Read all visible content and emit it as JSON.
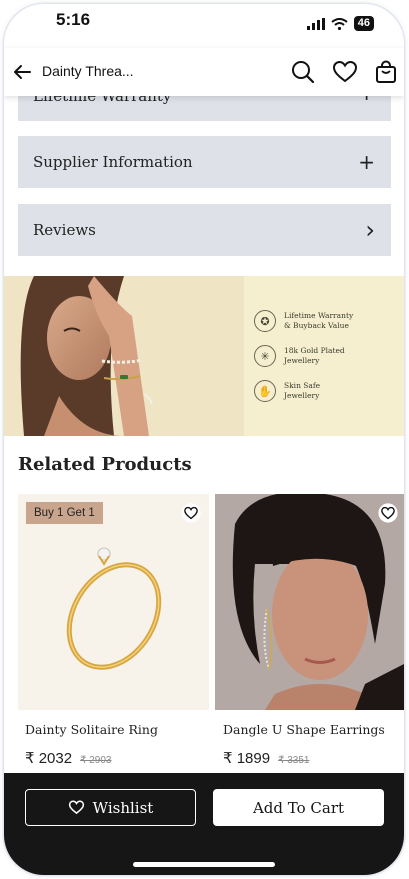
{
  "status": {
    "time": "5:16",
    "battery": "46"
  },
  "header": {
    "title": "Dainty Threa..."
  },
  "accordion": [
    {
      "label": "Lifetime Warranty",
      "sign": "+"
    },
    {
      "label": "Supplier Information",
      "sign": "+"
    },
    {
      "label": "Reviews",
      "sign": "›"
    }
  ],
  "banner": {
    "features": [
      {
        "line1": "Lifetime Warranty",
        "line2": "& Buyback Value",
        "icon": "certificate-icon"
      },
      {
        "line1": "18k Gold Plated",
        "line2": "Jewellery",
        "icon": "sparkle-icon"
      },
      {
        "line1": "Skin Safe",
        "line2": "Jewellery",
        "icon": "hand-icon"
      }
    ]
  },
  "related": {
    "title": "Related Products",
    "products": [
      {
        "badge": "Buy 1 Get 1",
        "name": "Dainty Solitaire Ring",
        "price": "₹ 2032",
        "original_price": "₹ 2903"
      },
      {
        "name": "Dangle U Shape Earrings",
        "price": "₹ 1899",
        "original_price": "₹ 3351"
      }
    ]
  },
  "actions": {
    "wishlist": "Wishlist",
    "add_to_cart": "Add To Cart"
  },
  "colors": {
    "accordion_bg": "#dfe1e9",
    "banner_bg": "#f6efcf",
    "bottom_bar": "#161616",
    "badge": "#c9a58e"
  }
}
